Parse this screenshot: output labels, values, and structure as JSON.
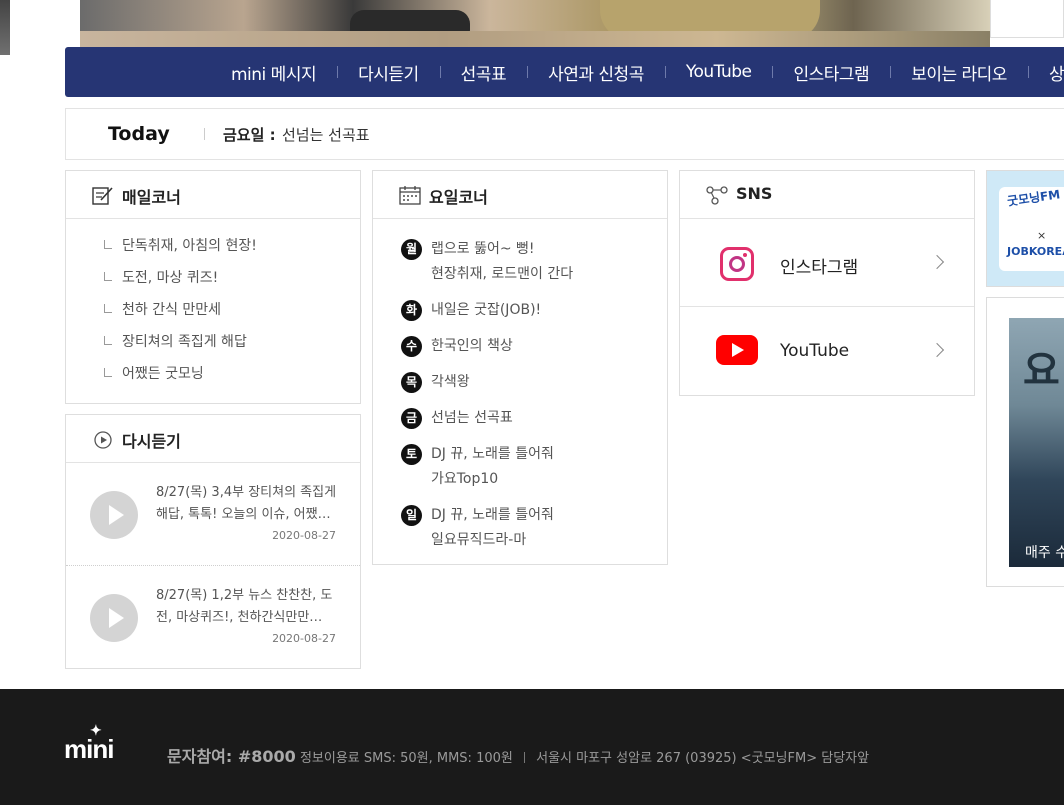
{
  "nav": {
    "items": [
      "mini 메시지",
      "다시듣기",
      "선곡표",
      "사연과 신청곡",
      "YouTube",
      "인스타그램",
      "보이는 라디오",
      "상"
    ]
  },
  "today": {
    "label": "Today",
    "day": "금요일 :",
    "program": "선넘는 선곡표"
  },
  "daily": {
    "title": "매일코너",
    "items": [
      "단독취재, 아침의 현장!",
      "도전, 마상 퀴즈!",
      "천하 간식 만만세",
      "장티쳐의 족집게 해답",
      "어쨌든 굿모닝"
    ]
  },
  "weekly": {
    "title": "요일코너",
    "items": [
      {
        "day": "월",
        "line1": "랩으로 뚫어~ 뻥!",
        "line2": "현장취재, 로드맨이 간다"
      },
      {
        "day": "화",
        "line1": "내일은 굿잡(JOB)!",
        "line2": ""
      },
      {
        "day": "수",
        "line1": "한국인의 책상",
        "line2": ""
      },
      {
        "day": "목",
        "line1": "각색왕",
        "line2": ""
      },
      {
        "day": "금",
        "line1": "선넘는 선곡표",
        "line2": ""
      },
      {
        "day": "토",
        "line1": "DJ 뀨, 노래를 틀어줘",
        "line2": "가요Top10"
      },
      {
        "day": "일",
        "line1": "DJ 뀨, 노래를 틀어줘",
        "line2": "일요뮤직드라-마"
      }
    ]
  },
  "sns": {
    "title": "SNS",
    "instagram": "인스타그램",
    "youtube": "YouTube"
  },
  "replay": {
    "title": "다시듣기",
    "items": [
      {
        "title": "8/27(목) 3,4부 장티쳐의 족집게 해답, 톡톡! 오늘의 이슈, 어쨌…",
        "date": "2020-08-27"
      },
      {
        "title": "8/27(목) 1,2부 뉴스 찬찬찬, 도전, 마상퀴즈!, 천하간식만만…",
        "date": "2020-08-27"
      }
    ]
  },
  "banners": {
    "b1_line1": "굿모닝FM",
    "b1_x": "×",
    "b1_line2": "JOBKOREA",
    "b2_big": "요",
    "b2_caption": "매주 수"
  },
  "footer": {
    "logo": "mini",
    "sms": "문자참여: #8000",
    "fee": "정보이용료 SMS: 50원, MMS: 100원",
    "address": "서울시 마포구 성암로 267 (03925) <굿모닝FM> 담당자앞"
  }
}
